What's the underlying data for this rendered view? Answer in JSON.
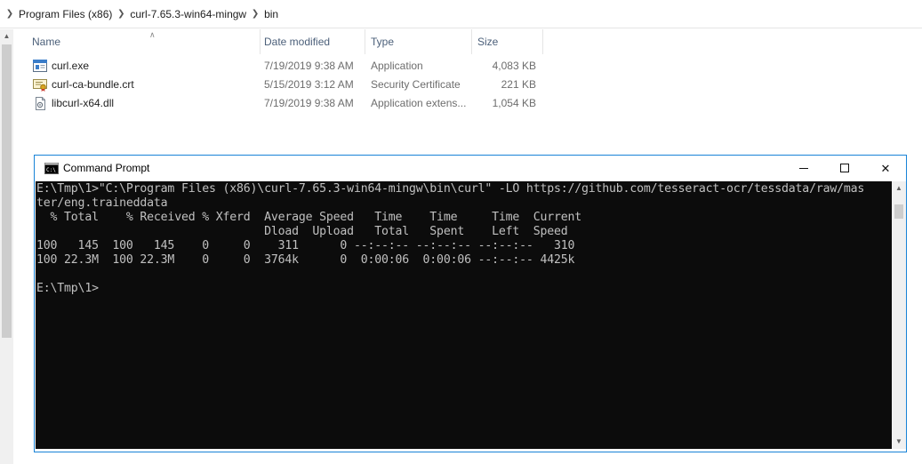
{
  "breadcrumb": {
    "items": [
      "Program Files (x86)",
      "curl-7.65.3-win64-mingw",
      "bin"
    ]
  },
  "columns": {
    "name": "Name",
    "date_modified": "Date modified",
    "type": "Type",
    "size": "Size"
  },
  "files": [
    {
      "name": "curl.exe",
      "date": "7/19/2019 9:38 AM",
      "type": "Application",
      "size": "4,083 KB",
      "icon": "application-icon"
    },
    {
      "name": "curl-ca-bundle.crt",
      "date": "5/15/2019 3:12 AM",
      "type": "Security Certificate",
      "size": "221 KB",
      "icon": "certificate-icon"
    },
    {
      "name": "libcurl-x64.dll",
      "date": "7/19/2019 9:38 AM",
      "type": "Application extens...",
      "size": "1,054 KB",
      "icon": "dll-icon"
    }
  ],
  "cmd": {
    "title": "Command Prompt",
    "lines": [
      "E:\\Tmp\\1>\"C:\\Program Files (x86)\\curl-7.65.3-win64-mingw\\bin\\curl\" -LO https://github.com/tesseract-ocr/tessdata/raw/mas",
      "ter/eng.traineddata",
      "  % Total    % Received % Xferd  Average Speed   Time    Time     Time  Current",
      "                                 Dload  Upload   Total   Spent    Left  Speed",
      "100   145  100   145    0     0    311      0 --:--:-- --:--:-- --:--:--   310",
      "100 22.3M  100 22.3M    0     0  3764k      0  0:00:06  0:00:06 --:--:-- 4425k",
      "",
      "E:\\Tmp\\1>"
    ]
  },
  "colors": {
    "console_bg": "#0c0c0c",
    "console_fg": "#c0c0c0",
    "window_border": "#1883d7",
    "header_text": "#4c607a"
  }
}
